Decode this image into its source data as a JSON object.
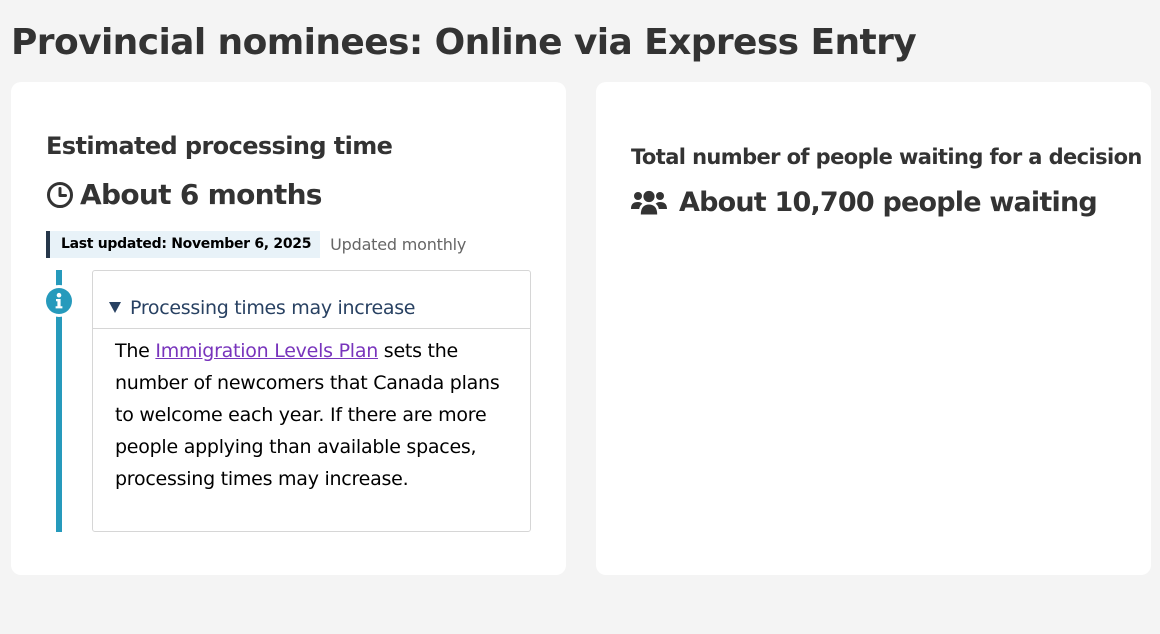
{
  "page": {
    "title": "Provincial nominees: Online via Express Entry"
  },
  "processing": {
    "heading": "Estimated processing time",
    "time_icon": "clock-icon",
    "time": "About 6 months",
    "last_updated": "Last updated: November 6, 2025",
    "update_frequency": "Updated monthly"
  },
  "notice": {
    "icon": "info-icon",
    "summary": "Processing times may increase",
    "body_before_link": "The ",
    "link_text": "Immigration Levels Plan",
    "body_after_link": " sets the number of newcomers that Canada plans to welcome each year. If there are more people applying than available spaces, processing times may increase.",
    "expanded": true
  },
  "waiting": {
    "heading": "Total number of people waiting for a decision",
    "icon": "users-icon",
    "count_text": "About 10,700 people waiting"
  },
  "colors": {
    "background": "#f4f4f4",
    "card": "#ffffff",
    "text": "#333333",
    "info_accent": "#269abc",
    "badge_bg": "#e8f2f8",
    "badge_border": "#26374a",
    "summary_text": "#284162",
    "link": "#7834bc"
  }
}
